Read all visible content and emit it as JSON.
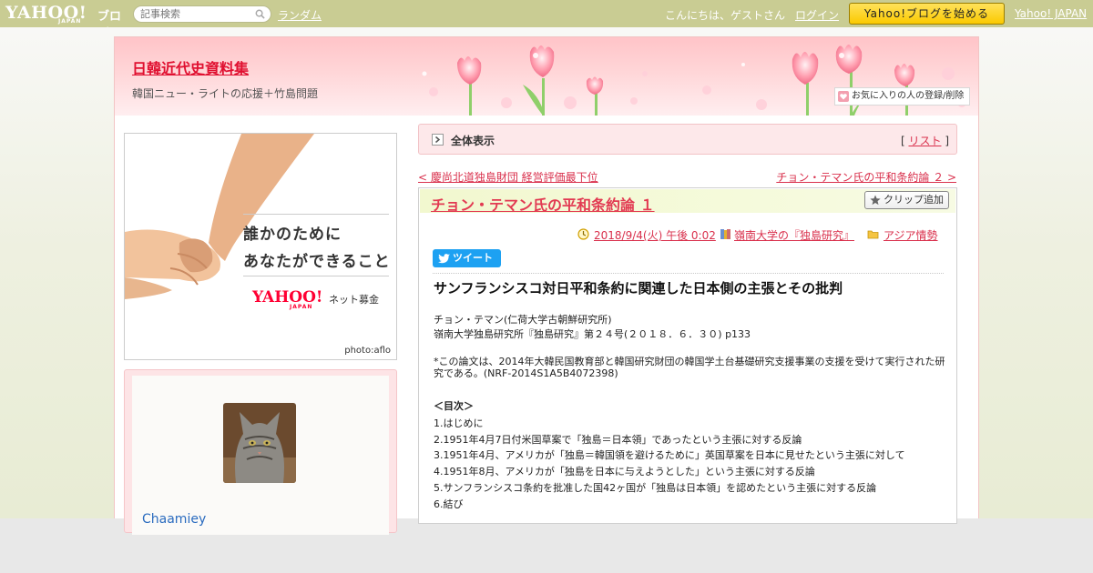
{
  "topbar": {
    "logo_text": "YAHOO!",
    "logo_sub": "JAPAN",
    "logo_blog": "ブログ",
    "search_placeholder": "記事検索",
    "random_label": "ランダム",
    "greeting": "こんにちは、ゲストさん",
    "login_label": "ログイン",
    "start_blog_label": "Yahoo!ブログを始める",
    "yahoo_japan_label": "Yahoo! JAPAN"
  },
  "blog": {
    "title": "日韓近代史資料集",
    "description": "韓国ニュー・ライトの応援＋竹島問題",
    "favorite_label": "お気に入りの人の登録/削除"
  },
  "ad": {
    "line1": "誰かのために",
    "line2": "あなたができること",
    "logo": "YAHOO!",
    "logo_sub": "JAPAN",
    "service": "ネット募金",
    "credit": "photo:aflo"
  },
  "profile": {
    "username": "Chaamiey"
  },
  "fullview": {
    "label": "全体表示",
    "list_open": "[",
    "list_label": "リスト",
    "list_close": "]"
  },
  "nav": {
    "prev_label": "< 慶尚北道独島財団 経営評価最下位",
    "next_label": "チョン・テマン氏の平和条約論 ２ >"
  },
  "article": {
    "title": "チョン・テマン氏の平和条約論 １",
    "clip_label": "クリップ追加",
    "date": "2018/9/4(火) 午後 0:02",
    "category1": "嶺南大学の『独島研究』",
    "category2": "アジア情勢",
    "tweet_label": "ツイート",
    "heading": "サンフランシスコ対日平和条約に関連した日本側の主張とその批判",
    "author": "チョン・テマン(仁荷大学古朝鮮研究所)",
    "source": "嶺南大学独島研究所『独島研究』第２４号(２０１８．６．３０) p133",
    "note": "*この論文は、2014年大韓民国教育部と韓国研究財団の韓国学土台基礎研究支援事業の支援を受けて実行された研究である。(NRF-2014S1A5B4072398)",
    "toc_title": "＜目次＞",
    "toc": [
      "1.はじめに",
      "2.1951年4月7日付米国草案で「独島＝日本領」であったという主張に対する反論",
      "3.1951年4月、アメリカが「独島＝韓国領を避けるために」英国草案を日本に見せたという主張に対して",
      "4.1951年8月、アメリカが「独島を日本に与えようとした」という主張に対する反論",
      "5.サンフランシスコ条約を批准した国42ヶ国が「独島は日本領」を認めたという主張に対する反論",
      "6.結び"
    ]
  },
  "colors": {
    "topbar": "#c9cc93",
    "link": "#d9304c",
    "title_red": "#e01030",
    "header_pink": "#ffc4c8",
    "tweet_blue": "#1da1f2",
    "start_yellow": "#fbc900"
  },
  "icons": {
    "search": "search-icon",
    "favorite": "heart-icon",
    "fullview": "arrow-box-icon",
    "clip": "star-icon",
    "clock": "clock-icon",
    "book": "book-icon",
    "folder": "folder-icon",
    "twitter": "twitter-bird-icon"
  }
}
